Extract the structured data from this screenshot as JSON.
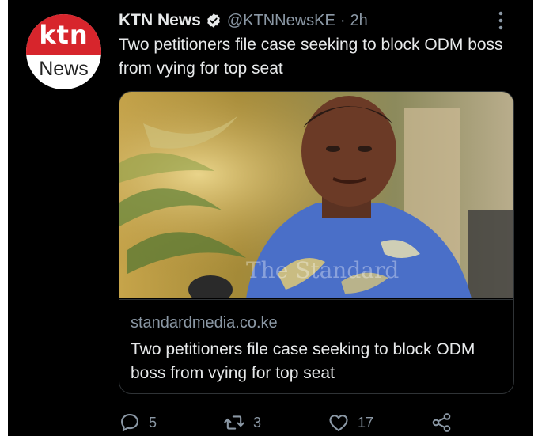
{
  "author": {
    "name": "KTN News",
    "handle": "@KTNNewsKE",
    "separator": "·",
    "time": "2h",
    "avatar_text_top": "ktn",
    "avatar_text_bottom": "News"
  },
  "tweet": {
    "text": "Two petitioners file case seeking to block ODM boss from vying for top seat"
  },
  "card": {
    "image_watermark": "The Standard",
    "domain": "standardmedia.co.ke",
    "title": "Two petitioners file case seeking to block ODM boss from vying for top seat"
  },
  "actions": {
    "replies": "5",
    "retweets": "3",
    "likes": "17"
  },
  "icons": [
    "verified-badge-icon",
    "more-vertical-icon",
    "reply-icon",
    "retweet-icon",
    "like-icon",
    "share-icon"
  ],
  "colors": {
    "background": "#000000",
    "text_primary": "#e7e9ea",
    "text_secondary": "#8b98a5",
    "border": "#2f3336",
    "ktn_red": "#d7252c"
  }
}
